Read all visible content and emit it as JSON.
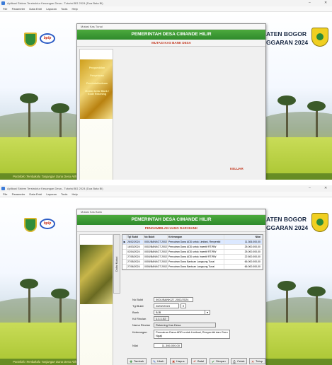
{
  "window": {
    "title": "Aplikasi Sistem Terstruktur Keuangan Desa - Tutorial BG 2024 (Dua Bata Bl)",
    "menu": [
      "File",
      "Parameter",
      "Data Entri",
      "Laporan",
      "Tools",
      "Help"
    ],
    "minimize": "–",
    "close": "✕"
  },
  "desktop": {
    "banner_line1": "ATEN BOGOR",
    "banner_line2": "GGARAN 2024",
    "bplp_logo_text": "bplp",
    "footer": "Portofolio Tembakalu Tunjangan Dana Desa Akhirnya dan Pencarian"
  },
  "screen1": {
    "window_title": "Mutasi Kas Tunai",
    "header": "PEMERINTAH DESA CIMANDE HILIR",
    "subheader": "MUTASI KAS BANK DESA",
    "side_menu": [
      "Pengambilan",
      "Penyetoran",
      "Pemindahbukuan",
      "Mutasi Antar Bank / Kode Rekening"
    ],
    "close_label": "KELUAR"
  },
  "screen2": {
    "window_title": "Mutasi Kas Bank",
    "header": "PEMERINTAH DESA CIMANDE HILIR",
    "subheader": "PENGAMBILAN UANG DARI BANK",
    "side_tab": "Daftar Mutasi",
    "table": {
      "columns": [
        "Tgl Bukti",
        "No Bukti",
        "Keterangan",
        "Nilai"
      ],
      "rows": [
        [
          "26/02/2024",
          "0001/BANK/27.2002/2024",
          "Pencairan Dana ADD untuk Limitasi, Renyentid",
          "11.306.000,00"
        ],
        [
          "16/03/2024",
          "0002/BANK/27.2002/2024",
          "Pencairan Dana ADD untuk Insentif RT/RW",
          "25.000.000,00"
        ],
        [
          "02/04/2024",
          "0003/BANK/27.2002/2024",
          "Pencairan Dana ADD untuk Insentif RT/RW",
          "25.000.000,00"
        ],
        [
          "27/05/2024",
          "0004/BANK/27.2002/2024",
          "Pencairan Dana ADD untuk Insentif RT/RW",
          "22.500.000,00"
        ],
        [
          "27/05/2024",
          "0005/BANK/27.2002/2024",
          "Pencairan Dana Bantuan Langsung Tunai",
          "66.000.000,00"
        ],
        [
          "27/06/2024",
          "0006/BANK/27.2002/2024",
          "Pencairan Dana Bantuan Langsung Tunai",
          "66.000.000,00"
        ]
      ],
      "selected_row": 0
    },
    "form": {
      "no_bukti_label": "No Bukti",
      "no_bukti": "0001/BANK/27.2002/2024",
      "tgl_bukti_label": "Tgl Bukti",
      "tgl_bukti": "26/02/2024",
      "bank_label": "Bank",
      "bank": "BJB",
      "kd_rincian_label": "Kd Rincian",
      "kd_rincian": "1.1.1.02",
      "nama_rincian_label": "Nama Rincian",
      "nama_rincian": "Rekening Kas Desa",
      "keterangan_label": "Keterangan",
      "keterangan": "Pencairan Dana ADD untuk Limitasi, Renyentid dan Guru Ngaji",
      "nilai_label": "Nilai",
      "nilai": "11.306.000,00"
    },
    "buttons": [
      "Tambah",
      "Ubah",
      "Hapus",
      "Batal",
      "Simpan",
      "Cetak",
      "Tutup"
    ]
  }
}
